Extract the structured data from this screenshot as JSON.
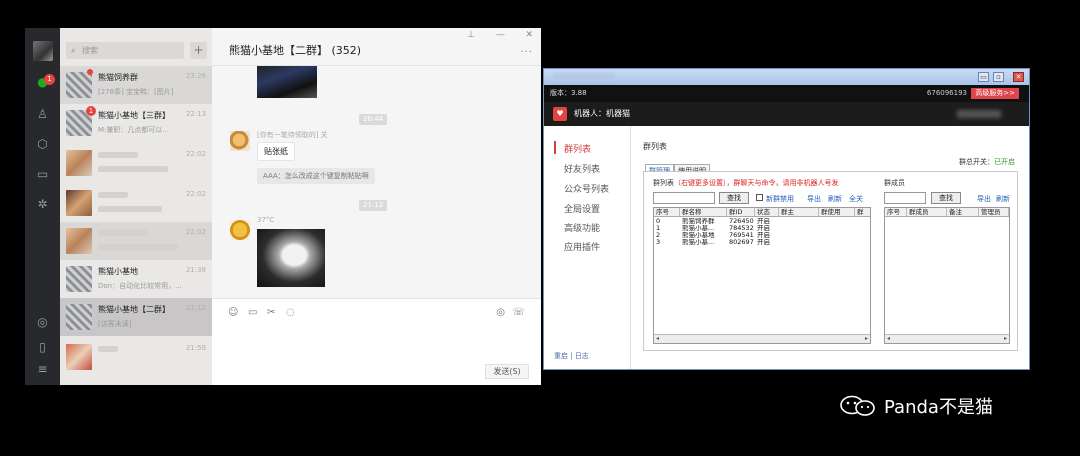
{
  "wechat": {
    "rail": {
      "badge": "1"
    },
    "search_placeholder": "搜索",
    "plus": "+",
    "conversations": [
      {
        "title": "熊猫饲养群",
        "sub": "[278条] 宝宝鸭：[图片]",
        "time": "23:26"
      },
      {
        "title": "熊猫小基地【三群】",
        "sub": "M:兼职：几点都可以...",
        "time": "22:13",
        "badge": "1"
      },
      {
        "title": "",
        "sub": "",
        "time": "22:02"
      },
      {
        "title": "",
        "sub": "",
        "time": "22:02"
      },
      {
        "title": "",
        "sub": "",
        "time": "22:02"
      },
      {
        "title": "熊猫小基地",
        "sub": "Don：自动化比较常用，...",
        "time": "21:38"
      },
      {
        "title": "熊猫小基地【二群】",
        "sub": "[访客未读]",
        "time": "21:12"
      },
      {
        "title": "",
        "sub": "",
        "time": "21:59"
      }
    ],
    "chat": {
      "title": "熊猫小基地【二群】",
      "count": "(352)",
      "pin": "⊥",
      "min": "—",
      "close": "✕",
      "more": "···",
      "timestamps": [
        "20:44",
        "21:12"
      ],
      "msg1": {
        "sender": "[你有一笔待领取的] 关",
        "text": "贴张纸",
        "quote": "AAA：怎么改成这个键复制粘贴啊"
      },
      "msg2": {
        "sender": "37°C"
      },
      "send": "发送(S)"
    }
  },
  "robot": {
    "version": "版本：3.88",
    "id": "676096193",
    "adv": "高级服务>>",
    "robot_label": "机器人：机器猫",
    "nav": [
      "群列表",
      "好友列表",
      "公众号列表",
      "全局设置",
      "高级功能",
      "应用插件"
    ],
    "footer": "重启  |  日志",
    "section_title": "群列表",
    "tabs": [
      "群管理",
      "使用说明"
    ],
    "switch_label": "群总开关：",
    "switch_value": "已开启",
    "left_label": "群列表",
    "left_hint": "（右键更多设置），群聊天与命令，请用非机器人号发",
    "find": "查找",
    "new_group_disable": "新群禁用",
    "export": "导出",
    "refresh": "刷新",
    "select_all": "全关",
    "members_label": "群成员",
    "group_cols": [
      "序号",
      "群名称",
      "群ID",
      "状态",
      "群主",
      "群使用",
      "群"
    ],
    "groups": [
      [
        "0",
        "熊猫饲养群",
        "726450",
        "开启"
      ],
      [
        "1",
        "熊猫小基...",
        "784532",
        "开启"
      ],
      [
        "2",
        "熊猫小基地",
        "769541",
        "开启"
      ],
      [
        "3",
        "熊猫小基...",
        "802697",
        "开启"
      ]
    ],
    "member_cols": [
      "序号",
      "群成员",
      "备注",
      "管理员"
    ]
  },
  "watermark": "Panda不是猫"
}
